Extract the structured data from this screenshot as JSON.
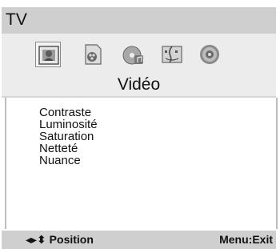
{
  "header": {
    "title": "TV"
  },
  "icons": [
    {
      "name": "photo-icon",
      "selected": true
    },
    {
      "name": "video-file-icon",
      "selected": false
    },
    {
      "name": "music-disc-icon",
      "selected": false
    },
    {
      "name": "file-manager-icon",
      "selected": false
    },
    {
      "name": "settings-icon",
      "selected": false
    }
  ],
  "section": {
    "title": "Vidéo"
  },
  "menu": {
    "items": [
      "Contraste",
      "Luminosité",
      "Saturation",
      "Netteté",
      "Nuance"
    ]
  },
  "status": {
    "left": "◂▸⬍ Position",
    "right": "Menu:Exit"
  },
  "colors": {
    "bar_background": "#cfcfcf",
    "panel_background": "#ececec",
    "content_background": "#ffffff"
  }
}
